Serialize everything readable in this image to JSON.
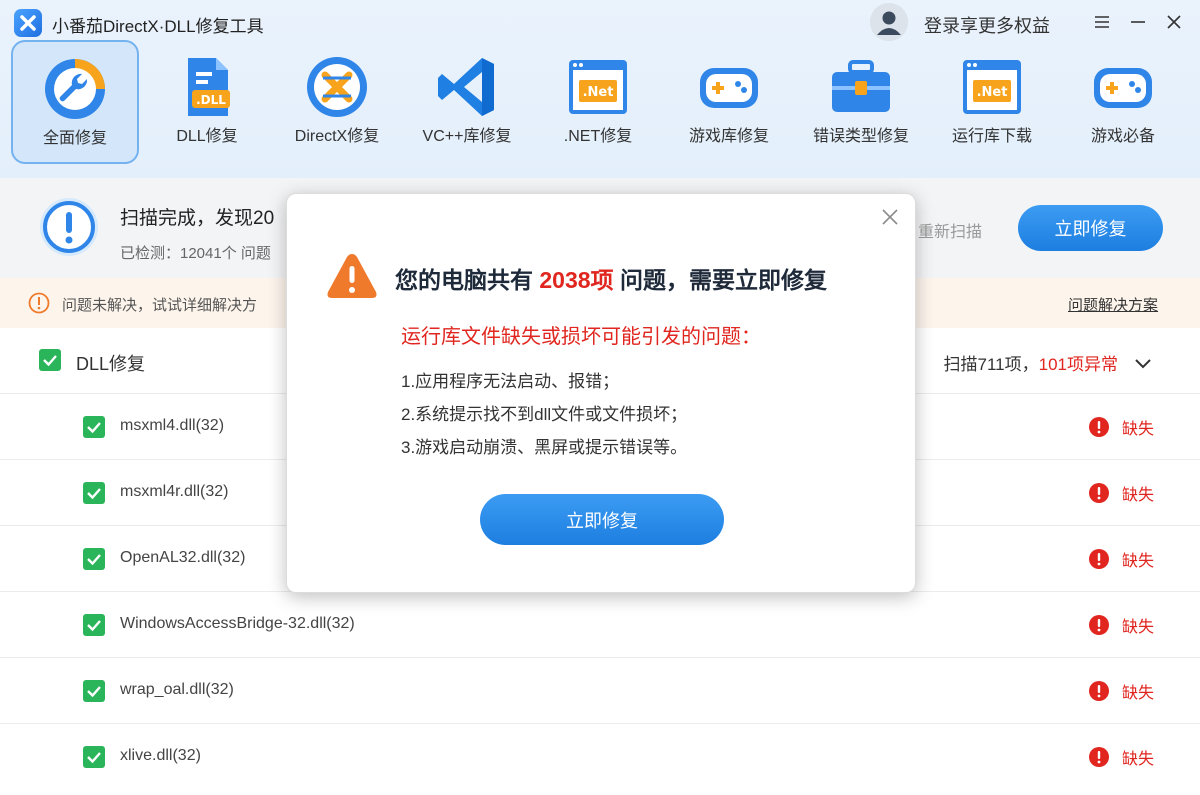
{
  "app": {
    "title": "小番茄DirectX·DLL修复工具"
  },
  "header": {
    "login_label": "登录享更多权益"
  },
  "toolbar": [
    {
      "label": "全面修复",
      "icon": "wrench-icon",
      "active": true
    },
    {
      "label": "DLL修复",
      "icon": "dll-file-icon"
    },
    {
      "label": "DirectX修复",
      "icon": "directx-icon"
    },
    {
      "label": "VC++库修复",
      "icon": "vscode-icon"
    },
    {
      "label": ".NET修复",
      "icon": "dotnet-window-icon"
    },
    {
      "label": "游戏库修复",
      "icon": "gamepad-icon"
    },
    {
      "label": "错误类型修复",
      "icon": "toolbox-icon"
    },
    {
      "label": "运行库下载",
      "icon": "dotnet-window-icon"
    },
    {
      "label": "游戏必备",
      "icon": "gamepad-icon"
    }
  ],
  "scan": {
    "title": "扫描完成，发现20",
    "subtitle": "已检测：12041个 问题",
    "rescan_label": "重新扫描",
    "fix_label": "立即修复"
  },
  "notice": {
    "text": "问题未解决，试试详细解决方",
    "link": "问题解决方案"
  },
  "group": {
    "label": "DLL修复",
    "stats_prefix": "扫描711项，",
    "stats_error": "101项异常"
  },
  "rows": [
    {
      "name": "msxml4.dll(32)",
      "status": "缺失"
    },
    {
      "name": "msxml4r.dll(32)",
      "status": "缺失"
    },
    {
      "name": "OpenAL32.dll(32)",
      "status": "缺失"
    },
    {
      "name": "WindowsAccessBridge-32.dll(32)",
      "status": "缺失"
    },
    {
      "name": "wrap_oal.dll(32)",
      "status": "缺失"
    },
    {
      "name": "xlive.dll(32)",
      "status": "缺失"
    }
  ],
  "modal": {
    "title_prefix": "您的电脑共有 ",
    "title_count": "2038项",
    "title_suffix": " 问题，需要立即修复",
    "subtitle": "运行库文件缺失或损坏可能引发的问题：",
    "items": [
      "1.应用程序无法启动、报错；",
      "2.系统提示找不到dll文件或文件损坏；",
      "3.游戏启动崩溃、黑屏或提示错误等。"
    ],
    "button_label": "立即修复"
  },
  "colors": {
    "accent": "#1d7ee0",
    "error": "#e0261f",
    "check": "#2bb55a",
    "warning": "#f07a2c"
  }
}
